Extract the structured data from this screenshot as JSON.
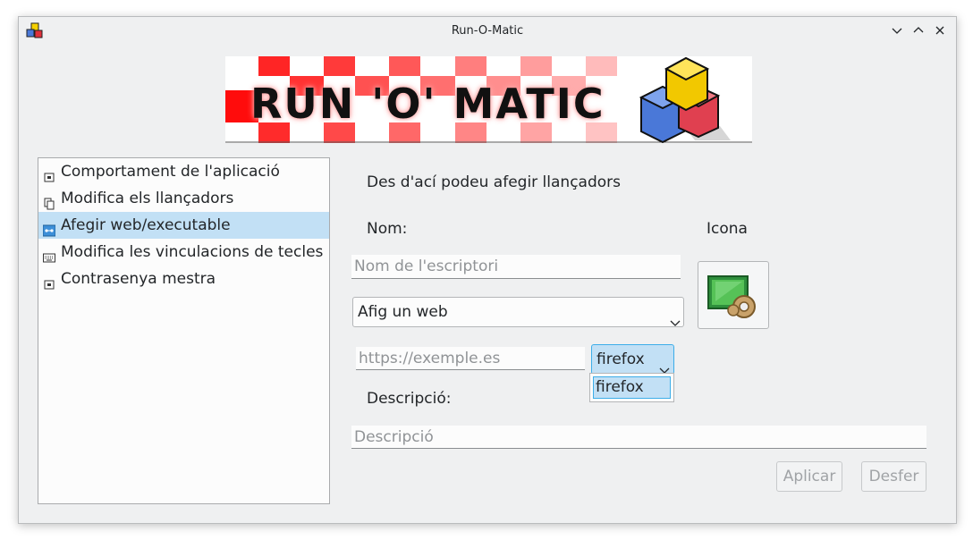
{
  "window": {
    "title": "Run-O-Matic"
  },
  "banner": {
    "text": "RUN 'O' MATIC"
  },
  "sidebar": {
    "items": [
      {
        "label": "Comportament de l'aplicació",
        "icon": "settings-window-icon",
        "selected": false
      },
      {
        "label": "Modifica els llançadors",
        "icon": "copy-icon",
        "selected": false
      },
      {
        "label": "Afegir web/executable",
        "icon": "network-icon",
        "selected": true
      },
      {
        "label": "Modifica les vinculacions de tecles",
        "icon": "keyboard-icon",
        "selected": false
      },
      {
        "label": "Contrasenya mestra",
        "icon": "password-window-icon",
        "selected": false
      }
    ]
  },
  "form": {
    "intro": "Des d'ací podeu afegir llançadors",
    "name_label": "Nom:",
    "icon_label": "Icona",
    "name_placeholder": "Nom de l'escriptori",
    "type_combo": {
      "value": "Afig un web"
    },
    "url_placeholder": "https://exemple.es",
    "browser_combo": {
      "value": "firefox",
      "options": [
        "firefox"
      ]
    },
    "description_label": "Descripció:",
    "description_placeholder": "Descripció",
    "apply_label": "Aplicar",
    "undo_label": "Desfer"
  }
}
